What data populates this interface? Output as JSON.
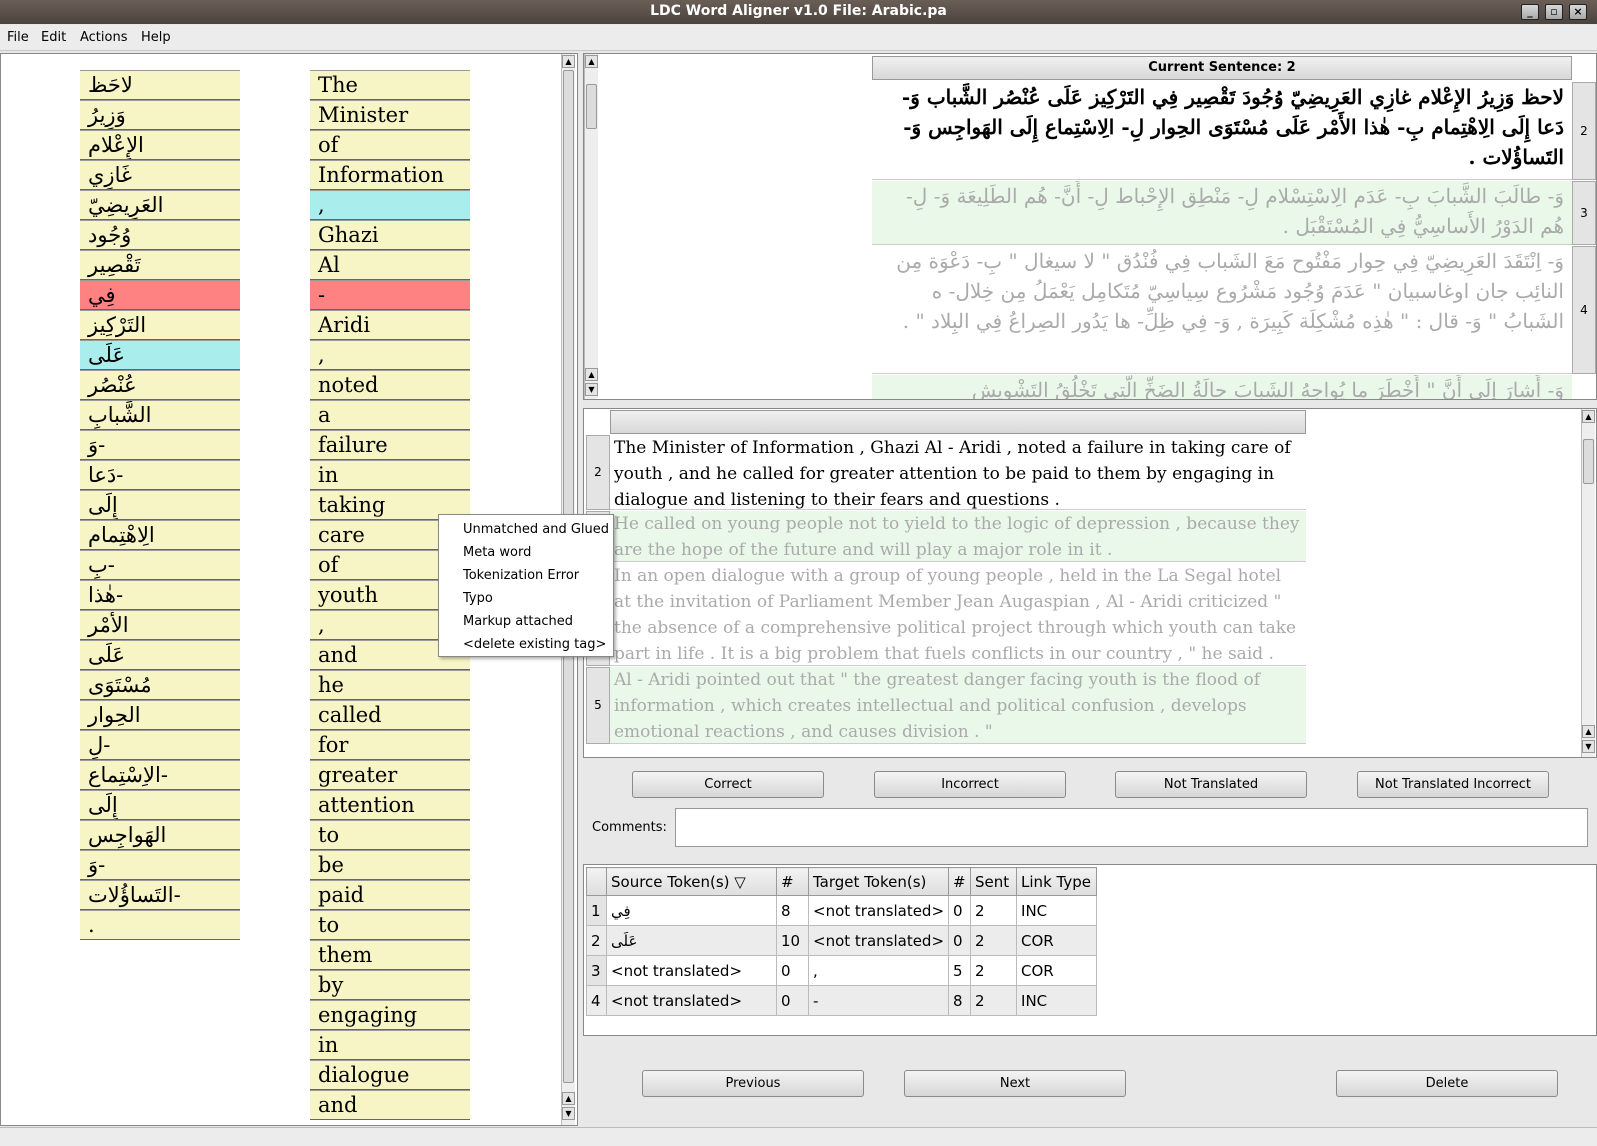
{
  "window": {
    "title": "LDC Word Aligner v1.0  File: Arabic.pa",
    "controls": [
      "_",
      "▫",
      "×"
    ]
  },
  "menu": [
    "File",
    "Edit",
    "Actions",
    "Help"
  ],
  "source_tokens": [
    "لاحَظ",
    "وَزِيرُ",
    "الإِعْلام",
    "غَازِي",
    "العَرِيضِيّ",
    "وُجُود",
    "تَقْصِير",
    "فِي",
    "التَرْكِيز",
    "عَلَى",
    "عُنْصُر",
    "الشَّبابِ",
    "وَ-",
    "دَعا-",
    "إِلَى",
    "الِاهْتِمام",
    "بِ-",
    "هٰذا-",
    "الأَمْر",
    "عَلَى",
    "مُسْتَوَى",
    "الحِوار",
    "لِ-",
    "الاِسْتِماع-",
    "إِلَى",
    "الهَواجِس",
    "وَ-",
    "التَساؤُلات-",
    "."
  ],
  "target_tokens": [
    "The",
    "Minister",
    "of",
    "Information",
    ",",
    "Ghazi",
    "Al",
    "-",
    "Aridi",
    ",",
    "noted",
    "a",
    "failure",
    "in",
    "taking",
    "care",
    "of",
    "youth",
    ",",
    "and",
    "he",
    "called",
    "for",
    "greater",
    "attention",
    "to",
    "be",
    "paid",
    "to",
    "them",
    "by",
    "engaging",
    "in",
    "dialogue",
    "and"
  ],
  "sentences": {
    "header": "Current Sentence: 2",
    "arabic": [
      {
        "num": "2",
        "text": "لاحظ وَزِيرُ الإِعْلام غازِي العَرِيضِيّ وُجُودَ تَقْصِير فِي التَرْكِيز عَلَى عُنْصُر الشَّباب وَ- دَعا إِلَى الِاهْتِمام بِ- هٰذا الأَمْر عَلَى مُسْتَوَى الحِوار لِ- الِاسْتِماع إِلَى الهَواجِس وَ- التَساؤُلات ."
      },
      {
        "num": "3",
        "text": "وَ- طالَبَ الشَّبابَ بِ- عَدَم الِاسْتِسْلام لِ- مَنْطِق الإِحْباط لِ- أَنَّ- هُم الطَلِيعَة وَ- لِ- هُم الدَوْرُ الأَساسِيُّ فِي المُسْتَقْبَل ."
      },
      {
        "num": "4",
        "text": "وَ- اِنْتَقَدَ العَرِيضِيّ فِي حِوار مَفْتُوح مَعَ الشَباب فِي فُنْدُق \" لا سيغال \" بِ- دَعْوَة مِن النائِب جان اوغاسبيان \" عَدَمَ وُجُود مَشْرُوع سِياسِيّ مُتَكامِل يَعْمَلُ مِن خِلال- ه الشَبابُ \" وَ- قال : \" هٰذِه مُشْكِلَة كَبِيرَة , وَ- فِي ظِلِّ- ها يَدُور الصِراعُ فِي البِلاد \" ."
      },
      {
        "num": "5",
        "text": "وَ- أَشارَ إِلَى أَنَّ \" أَخْطَرَ ما يُواجِهُ الشَبابَ حالَةُ الضَخِّ الَّتِي تَخْلُقُ التَشْوِيش"
      }
    ],
    "english": [
      {
        "num": "2",
        "text": "The Minister of Information , Ghazi Al - Aridi , noted a failure in taking care of youth , and he called for greater attention to be paid to them by engaging in dialogue and listening to their fears and questions ."
      },
      {
        "num": "3",
        "text": "He called on young people not to yield to the logic of depression , because they are the hope of the future and will play a major role in it ."
      },
      {
        "num": "4",
        "text": "In an open dialogue with a group of young people , held in the La Segal hotel at the invitation of Parliament Member Jean Augaspian , Al - Aridi criticized \" the absence of a comprehensive political project through which youth can take part in life . It is a big problem that fuels conflicts in our country , \" he said ."
      },
      {
        "num": "5",
        "text": "Al - Aridi pointed out that \" the greatest danger facing youth is the flood of information , which creates intellectual and political confusion , develops emotional reactions , and causes division . \""
      }
    ]
  },
  "buttons": {
    "correct": "Correct",
    "incorrect": "Incorrect",
    "not_translated": "Not Translated",
    "not_translated_incorrect": "Not Translated Incorrect",
    "previous": "Previous",
    "next": "Next",
    "delete": "Delete"
  },
  "comments": {
    "label": "Comments:",
    "value": ""
  },
  "links_table": {
    "headers": [
      "Source Token(s)",
      "#",
      "Target Token(s)",
      "#",
      "Sent",
      "Link Type"
    ],
    "rows": [
      [
        "1",
        "فِي",
        "8",
        "<not translated>",
        "0",
        "2",
        "INC"
      ],
      [
        "2",
        "عَلَى",
        "10",
        "<not translated>",
        "0",
        "2",
        "COR"
      ],
      [
        "3",
        "<not translated>",
        "0",
        ",",
        "5",
        "2",
        "COR"
      ],
      [
        "4",
        "<not translated>",
        "0",
        "-",
        "8",
        "2",
        "INC"
      ]
    ]
  },
  "context_menu": [
    "Unmatched and Glued",
    "Meta word",
    "Tokenization Error",
    "Typo",
    "Markup attached",
    "<delete existing tag>"
  ],
  "colors": {
    "token_bg": "#f7f5c5",
    "selected_red": "#ff8282",
    "selected_cyan": "#a9eded",
    "faded_row": "#eaf8ea"
  }
}
